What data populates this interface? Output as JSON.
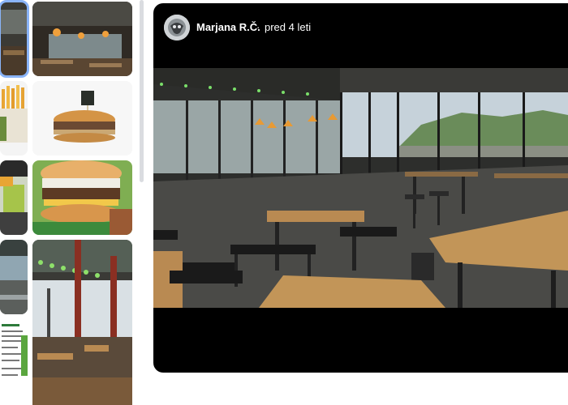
{
  "viewer": {
    "author": "Marjana R.Č.",
    "separator": "·",
    "time_ago": "pred 4 leti"
  },
  "gallery": {
    "thumbnails": [
      {
        "name": "restaurant-interior-photo"
      },
      {
        "name": "fries-photo"
      },
      {
        "name": "burger-photo"
      },
      {
        "name": "burger-closeup-photo"
      },
      {
        "name": "terrace-photo"
      },
      {
        "name": "menu-photo"
      },
      {
        "name": "restaurant-lights-photo"
      }
    ]
  },
  "colors": {
    "selected_outline": "#8ab4f8",
    "viewer_bg": "#000000"
  }
}
